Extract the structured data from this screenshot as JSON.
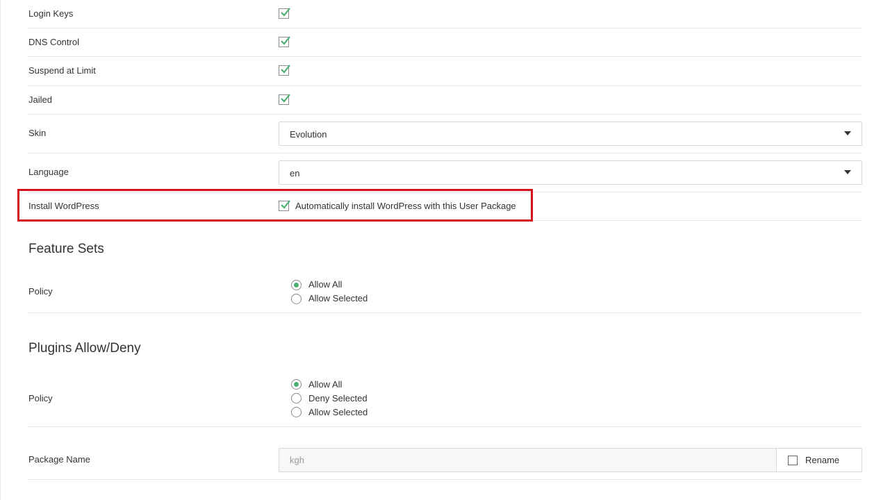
{
  "rows": {
    "login_keys": {
      "label": "Login Keys",
      "checked": true
    },
    "dns_control": {
      "label": "DNS Control",
      "checked": true
    },
    "suspend_limit": {
      "label": "Suspend at Limit",
      "checked": true
    },
    "jailed": {
      "label": "Jailed",
      "checked": true
    },
    "skin": {
      "label": "Skin",
      "value": "Evolution"
    },
    "language": {
      "label": "Language",
      "value": "en"
    },
    "install_wp": {
      "label": "Install WordPress",
      "checkbox_label": "Automatically install WordPress with this User Package",
      "checked": true
    }
  },
  "feature_sets": {
    "title": "Feature Sets",
    "policy_label": "Policy",
    "options": [
      "Allow All",
      "Allow Selected"
    ],
    "selected": "Allow All"
  },
  "plugins": {
    "title": "Plugins Allow/Deny",
    "policy_label": "Policy",
    "options": [
      "Allow All",
      "Deny Selected",
      "Allow Selected"
    ],
    "selected": "Allow All"
  },
  "package": {
    "label": "Package Name",
    "value": "kgh",
    "rename_label": "Rename",
    "rename_checked": false
  },
  "colors": {
    "accent": "#4caf72",
    "highlight": "#d4101c"
  }
}
